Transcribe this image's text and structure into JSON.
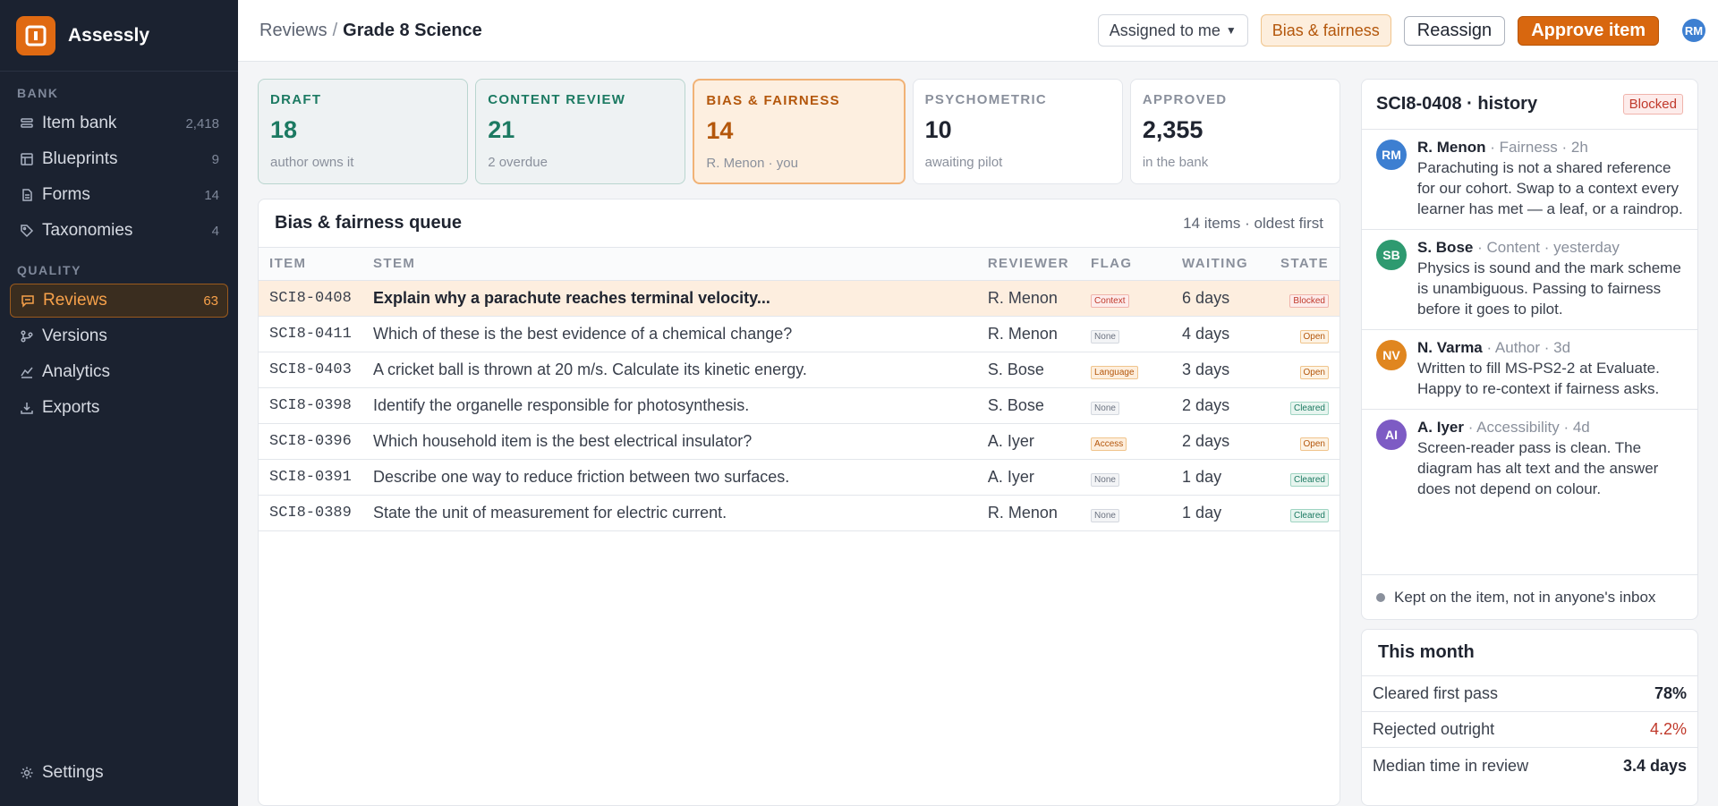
{
  "app": {
    "name": "Assessly"
  },
  "sidebar": {
    "sections": [
      {
        "title": "BANK",
        "items": [
          {
            "label": "Item bank",
            "count": "2,418",
            "icon": "stack-icon"
          },
          {
            "label": "Blueprints",
            "count": "9",
            "icon": "grid-icon"
          },
          {
            "label": "Forms",
            "count": "14",
            "icon": "file-icon"
          },
          {
            "label": "Taxonomies",
            "count": "4",
            "icon": "tag-icon"
          }
        ]
      },
      {
        "title": "QUALITY",
        "items": [
          {
            "label": "Reviews",
            "count": "63",
            "icon": "chat-icon",
            "active": true
          },
          {
            "label": "Versions",
            "count": "",
            "icon": "branch-icon"
          },
          {
            "label": "Analytics",
            "count": "",
            "icon": "analytics-icon"
          },
          {
            "label": "Exports",
            "count": "",
            "icon": "download-icon"
          }
        ]
      }
    ],
    "settings": "Settings"
  },
  "topbar": {
    "crumb_root": "Reviews",
    "crumb_sep": "/",
    "crumb_current": "Grade 8 Science",
    "filter": "Assigned to me",
    "stage_tag": "Bias & fairness",
    "reassign": "Reassign",
    "approve": "Approve item",
    "user_initials": "RM"
  },
  "stages": [
    {
      "title": "DRAFT",
      "count": "18",
      "sub": "author owns it",
      "style": "draft"
    },
    {
      "title": "CONTENT REVIEW",
      "count": "21",
      "sub": "2 overdue",
      "style": "review"
    },
    {
      "title": "BIAS & FAIRNESS",
      "count": "14",
      "sub": "R. Menon · you",
      "style": "bias"
    },
    {
      "title": "PSYCHOMETRIC",
      "count": "10",
      "sub": "awaiting pilot",
      "style": "plain"
    },
    {
      "title": "APPROVED",
      "count": "2,355",
      "sub": "in the bank",
      "style": "plain"
    }
  ],
  "queue": {
    "title": "Bias & fairness queue",
    "meta": "14 items · oldest first",
    "columns": [
      "ITEM",
      "STEM",
      "REVIEWER",
      "FLAG",
      "WAITING",
      "STATE"
    ],
    "rows": [
      {
        "id": "SCI8-0408",
        "stem": "Explain why a parachute reaches terminal velocity...",
        "reviewer": "R. Menon",
        "flag": "Context",
        "flag_style": "f-context",
        "waiting": "6 days",
        "state": "Blocked",
        "state_style": "s-blocked",
        "selected": true
      },
      {
        "id": "SCI8-0411",
        "stem": "Which of these is the best evidence of a chemical change?",
        "reviewer": "R. Menon",
        "flag": "None",
        "flag_style": "f-none",
        "waiting": "4 days",
        "state": "Open",
        "state_style": "s-open"
      },
      {
        "id": "SCI8-0403",
        "stem": "A cricket ball is thrown at 20 m/s. Calculate its kinetic energy.",
        "reviewer": "S. Bose",
        "flag": "Language",
        "flag_style": "f-language",
        "waiting": "3 days",
        "state": "Open",
        "state_style": "s-open"
      },
      {
        "id": "SCI8-0398",
        "stem": "Identify the organelle responsible for photosynthesis.",
        "reviewer": "S. Bose",
        "flag": "None",
        "flag_style": "f-none",
        "waiting": "2 days",
        "state": "Cleared",
        "state_style": "s-cleared"
      },
      {
        "id": "SCI8-0396",
        "stem": "Which household item is the best electrical insulator?",
        "reviewer": "A. Iyer",
        "flag": "Access",
        "flag_style": "f-access",
        "waiting": "2 days",
        "state": "Open",
        "state_style": "s-open"
      },
      {
        "id": "SCI8-0391",
        "stem": "Describe one way to reduce friction between two surfaces.",
        "reviewer": "A. Iyer",
        "flag": "None",
        "flag_style": "f-none",
        "waiting": "1 day",
        "state": "Cleared",
        "state_style": "s-cleared"
      },
      {
        "id": "SCI8-0389",
        "stem": "State the unit of measurement for electric current.",
        "reviewer": "R. Menon",
        "flag": "None",
        "flag_style": "f-none",
        "waiting": "1 day",
        "state": "Cleared",
        "state_style": "s-cleared"
      }
    ]
  },
  "history": {
    "title": "SCI8-0408 · history",
    "badge": "Blocked",
    "comments": [
      {
        "initials": "RM",
        "color": "#3d7fd1",
        "who": "R. Menon",
        "meta": " · Fairness · 2h",
        "body": "Parachuting is not a shared reference for our cohort. Swap to a context every learner has met — a leaf, or a raindrop."
      },
      {
        "initials": "SB",
        "color": "#2e9a70",
        "who": "S. Bose",
        "meta": " · Content · yesterday",
        "body": "Physics is sound and the mark scheme is unambiguous. Passing to fairness before it goes to pilot."
      },
      {
        "initials": "NV",
        "color": "#e0861f",
        "who": "N. Varma",
        "meta": " · Author · 3d",
        "body": "Written to fill MS-PS2-2 at Evaluate. Happy to re-context if fairness asks."
      },
      {
        "initials": "AI",
        "color": "#7d5bc4",
        "who": "A. Iyer",
        "meta": " · Accessibility · 4d",
        "body": "Screen-reader pass is clean. The diagram has alt text and the answer does not depend on colour."
      }
    ],
    "footer": "Kept on the item, not in anyone's inbox"
  },
  "month": {
    "title": "This month",
    "stats": [
      {
        "label": "Cleared first pass",
        "value": "78%",
        "red": false
      },
      {
        "label": "Rejected outright",
        "value": "4.2%",
        "red": true
      },
      {
        "label": "Median time in review",
        "value": "3.4 days",
        "red": false
      }
    ]
  }
}
